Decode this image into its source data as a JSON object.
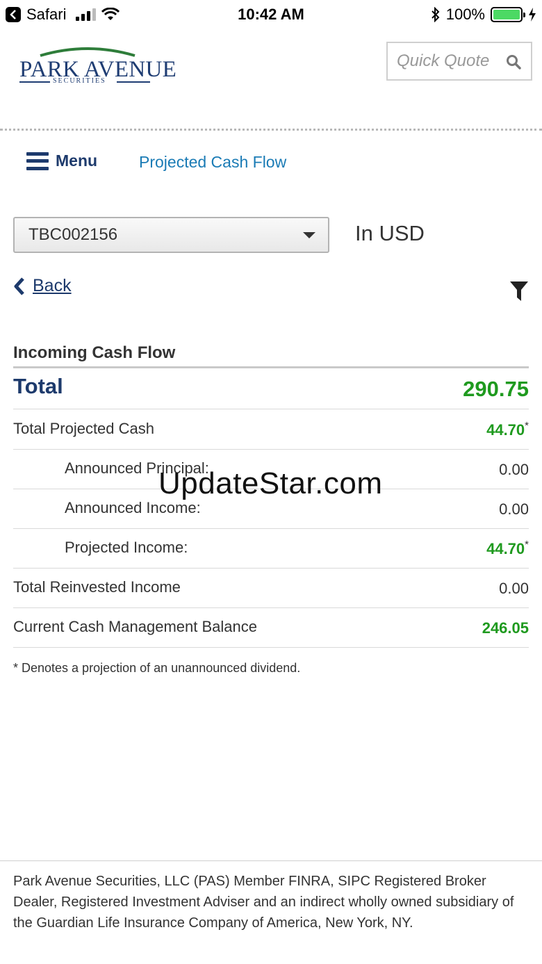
{
  "status_bar": {
    "app": "Safari",
    "time": "10:42 AM",
    "battery": "100%",
    "battery_level": 1.0,
    "signal_bars": 3
  },
  "header": {
    "logo_text": "PARK AVENUE",
    "logo_subtext": "SECURITIES",
    "quick_quote_placeholder": "Quick Quote"
  },
  "nav": {
    "menu_label": "Menu",
    "page_title": "Projected Cash Flow"
  },
  "account": {
    "selected": "TBC002156",
    "currency": "In USD"
  },
  "back_label": "Back",
  "cash_flow": {
    "section_title": "Incoming Cash Flow",
    "total_label": "Total",
    "total_value": "290.75",
    "rows": [
      {
        "label": "Total Projected Cash",
        "value": "44.70",
        "marker": "*"
      },
      {
        "label": "Announced Principal:",
        "value": "0.00"
      },
      {
        "label": "Announced Income:",
        "value": "0.00"
      },
      {
        "label": "Projected Income:",
        "value": "44.70",
        "marker": "*"
      },
      {
        "label": "Total Reinvested Income",
        "value": "0.00"
      },
      {
        "label": "Current Cash Management Balance",
        "value": "246.05"
      }
    ],
    "footnote": "* Denotes a projection of an unannounced dividend."
  },
  "watermark": "UpdateStar.com",
  "footer": {
    "disclaimer": "Park Avenue Securities, LLC (PAS) Member FINRA, SIPC Registered Broker Dealer, Registered Investment Adviser and an indirect wholly owned subsidiary of the Guardian Life Insurance Company of America, New York, NY."
  },
  "colors": {
    "brand_navy": "#1d3a6c",
    "link_blue": "#1a7bb5",
    "positive_green": "#1f9a1f"
  }
}
